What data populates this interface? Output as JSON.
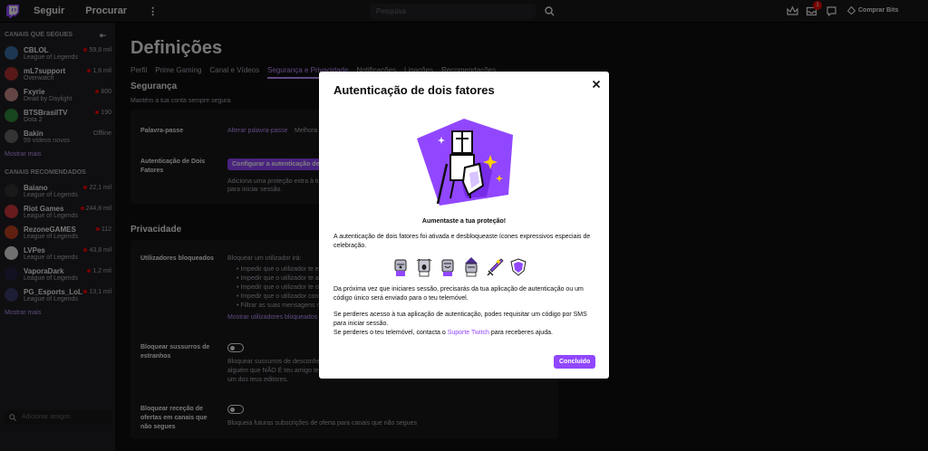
{
  "topbar": {
    "follow_label": "Seguir",
    "browse_label": "Procurar",
    "search_placeholder": "Pesquisa",
    "notif_count": "1",
    "bits_label": "Comprar Bits",
    "accent": "#9147ff"
  },
  "sidebar": {
    "followed_title": "CANAIS QUE SEGUES",
    "followed": [
      {
        "name": "CBLOL",
        "game": "League of Legends",
        "viewers": "59,8 mil",
        "live": true,
        "color": "#3a6ea5"
      },
      {
        "name": "mL7support",
        "game": "Overwatch",
        "viewers": "1,6 mil",
        "live": true,
        "color": "#b03030"
      },
      {
        "name": "Fxyrie",
        "game": "Dead by Daylight",
        "viewers": "800",
        "live": true,
        "color": "#c98b8b"
      },
      {
        "name": "BTSBrasilTV",
        "game": "Dota 2",
        "viewers": "190",
        "live": true,
        "color": "#2e8b3a"
      },
      {
        "name": "Bakin",
        "game": "59 vídeos novos",
        "viewers": "Offline",
        "live": false,
        "color": "#666666"
      }
    ],
    "more1": "Mostrar mais",
    "rec_title": "CANAIS RECOMENDADOS",
    "recommended": [
      {
        "name": "Baiano",
        "game": "League of Legends",
        "viewers": "22,1 mil",
        "color": "#333333"
      },
      {
        "name": "Riot Games",
        "game": "League of Legends",
        "viewers": "244,8 mil",
        "color": "#d13639"
      },
      {
        "name": "RezoneGAMES",
        "game": "League of Legends",
        "viewers": "112",
        "color": "#c04020"
      },
      {
        "name": "LVPes",
        "game": "League of Legends",
        "viewers": "43,8 mil",
        "color": "#e0e0e0"
      },
      {
        "name": "VaporaDark",
        "game": "League of Legends",
        "viewers": "1,2 mil",
        "color": "#222244"
      },
      {
        "name": "PG_Esports_LoL",
        "game": "League of Legends",
        "viewers": "13,1 mil",
        "color": "#3a3a6a"
      }
    ],
    "more2": "Mostrar mais",
    "friends_placeholder": "Adicionar amigos"
  },
  "settings": {
    "title": "Definições",
    "tabs": [
      "Perfil",
      "Prime Gaming",
      "Canal e Vídeos",
      "Segurança e Privacidade",
      "Notificações",
      "Ligações",
      "Recomendações"
    ],
    "security_title": "Segurança",
    "security_sub": "Mantém a tua conta sempre segura",
    "password_label": "Palavra-passe",
    "password_link": "Alterar palavra-passe",
    "password_hint": "Melhora a tua segurança com uma palavra-passe forte.",
    "twofa_label": "Autenticação de Dois Fatores",
    "twofa_button": "Configurar a autenticação de dois fatores",
    "twofa_desc1": "Adiciona uma proteção extra à tua conta ao exigir um código ao",
    "twofa_desc2": "para iniciar sessão.",
    "privacy_title": "Privacidade",
    "blocked_label": "Utilizadores bloqueados",
    "blocked_desc": "Bloquear um utilizador irá:",
    "blocked_items": [
      "Impedir que o utilizador te envie sussurros",
      "Impedir que o utilizador te adicione como amigo",
      "Impedir que o utilizador te ofereça subscrições",
      "Impedir que o utilizador consiga alojar o teu canal",
      "Filtrar as suas mensagens nos chats"
    ],
    "blocked_link": "Mostrar utilizadores bloqueados",
    "whispers_label": "Bloquear sussurros de estranhos",
    "whispers_desc1": "Bloquear sussurros de desconhecidos impede que",
    "whispers_desc2": "alguém que NÃO É teu amigo te envie sussurros,",
    "whispers_desc3": "um dos teus editores.",
    "gifts_label": "Bloquear receção de ofertas em canais que não segues",
    "gifts_desc": "Bloqueia futuras subscrições de oferta para canais que não segues"
  },
  "modal": {
    "title": "Autenticação de dois fatores",
    "headline": "Aumentaste a tua proteção!",
    "p1": "A autenticação de dois fatores foi ativada e desbloqueaste ícones expressivos especiais de celebração.",
    "emotes": [
      "knight-surprised-emote",
      "knight-scream-emote",
      "knight-happy-emote",
      "knight-wizard-emote",
      "sword-emote",
      "shield-emote"
    ],
    "p2": "Da próxima vez que iniciares sessão, precisarás da tua aplicação de autenticação ou um código único será enviado para o teu telemóvel.",
    "p3a": "Se perderes acesso à tua aplicação de autenticação, podes requisitar um código por SMS para iniciar sessão.",
    "p3b_pre": "Se perderes o teu telemóvel, contacta o ",
    "p3b_link": "Suporte Twitch",
    "p3b_post": " para receberes ajuda.",
    "done_label": "Concluído"
  }
}
